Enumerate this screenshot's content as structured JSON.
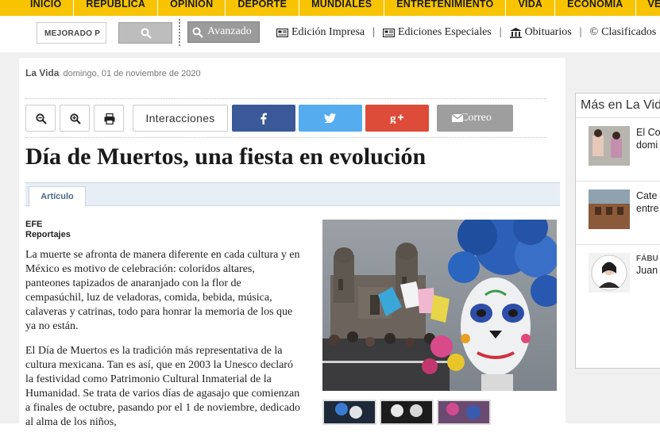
{
  "nav": {
    "items": [
      "INICIO",
      "REPÚBLICA",
      "OPINIÓN",
      "DEPORTE",
      "MUNDIALES",
      "ENTRETENIMIENTO",
      "VIDA",
      "ECONOMÍA",
      "VENTANA"
    ]
  },
  "search": {
    "placeholder": "MEJORADO P",
    "advanced_label": "Avanzado"
  },
  "links": [
    {
      "label": "Edición Impresa",
      "icon": "newspaper-icon"
    },
    {
      "label": "Ediciones Especiales",
      "icon": "newspaper-icon"
    },
    {
      "label": "Obituarios",
      "icon": "building-icon"
    },
    {
      "label": "Clasificados",
      "icon": "copyright-icon"
    }
  ],
  "article": {
    "section": "La Vida",
    "date": "domingo, 01 de noviembre de 2020",
    "interactions_label": "Interacciones",
    "email_label": "Correo",
    "title": "Día de Muertos, una fiesta en evolución",
    "tab": "Artículo",
    "source": "EFE",
    "category": "Reportajes",
    "paragraphs": [
      "La muerte se afronta de manera diferente en cada cultura y en México es motivo de celebración: coloridos altares, panteones tapizados de anaranjado con la flor de cempasúchil, luz de veladoras, comida, bebida, música, calaveras y catrinas, todo para honrar la memoria de los que ya no están.",
      "El Día de Muertos es la tradición más representativa de la cultura mexicana. Tan es así, que en 2003 la Unesco declaró la festividad como Patrimonio Cultural Inmaterial de la Humanidad. Se trata de varios días de agasajo que comienzan a finales de octubre, pasando por el 1 de noviembre, dedicado al alma de los niños,"
    ]
  },
  "sidebar": {
    "title": "Más en La Vida",
    "items": [
      {
        "line1": "El Co",
        "line2": "domi"
      },
      {
        "line1": "Cate",
        "line2": "entre"
      },
      {
        "label": "FÁBU",
        "line1": "Juan"
      }
    ]
  },
  "colors": {
    "nav_bg": "#f8c400",
    "facebook": "#3b5998",
    "twitter": "#55acee",
    "googleplus": "#dd4b39",
    "email": "#9e9e9e"
  }
}
